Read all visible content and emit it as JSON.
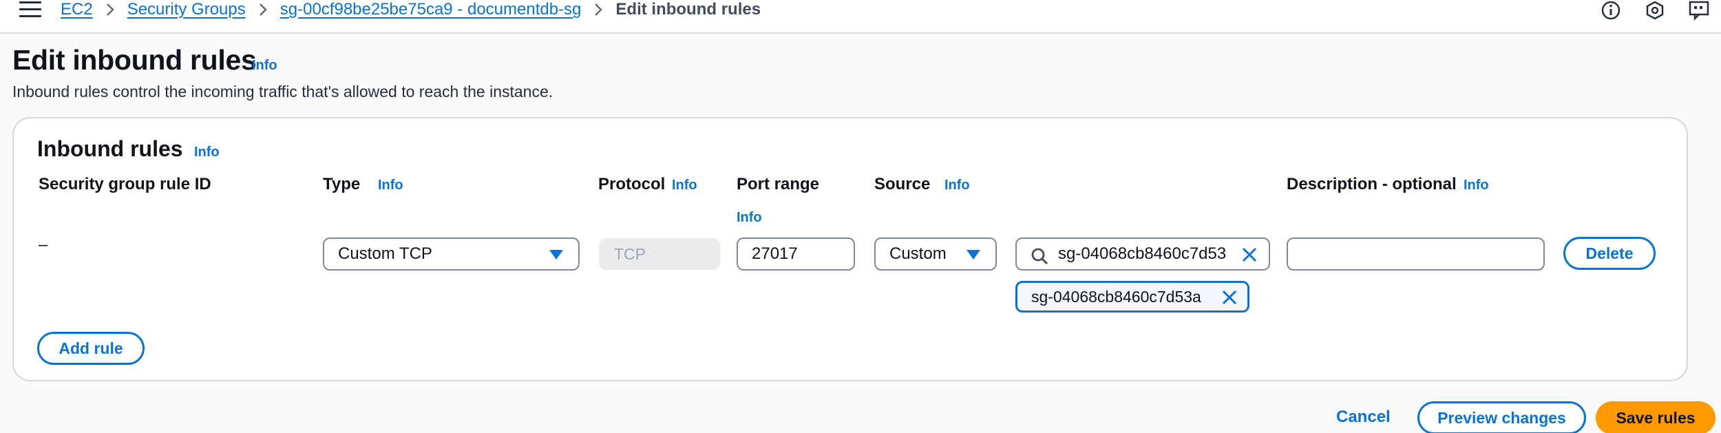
{
  "breadcrumb": {
    "items": [
      "EC2",
      "Security Groups",
      "sg-00cf98be25be75ca9 - documentdb-sg"
    ],
    "current": "Edit inbound rules"
  },
  "header": {
    "title": "Edit inbound rules",
    "info": "Info",
    "description": "Inbound rules control the incoming traffic that's allowed to reach the instance."
  },
  "panel": {
    "title": "Inbound rules",
    "info": "Info",
    "columns": {
      "rule_id": "Security group rule ID",
      "type": "Type",
      "protocol": "Protocol",
      "port_range": "Port range",
      "source": "Source",
      "description": "Description - optional",
      "info": "Info"
    },
    "rule": {
      "rule_id": "–",
      "type": "Custom TCP",
      "protocol": "TCP",
      "port_range": "27017",
      "source_type": "Custom",
      "source_search": "sg-04068cb8460c7d53",
      "source_token": "sg-04068cb8460c7d53a",
      "description": "",
      "delete_label": "Delete"
    },
    "add_rule_label": "Add rule"
  },
  "footer": {
    "cancel_label": "Cancel",
    "preview_label": "Preview changes",
    "save_label": "Save rules"
  },
  "colors": {
    "accent": "#0972d3",
    "primary_button": "#ff9900"
  }
}
